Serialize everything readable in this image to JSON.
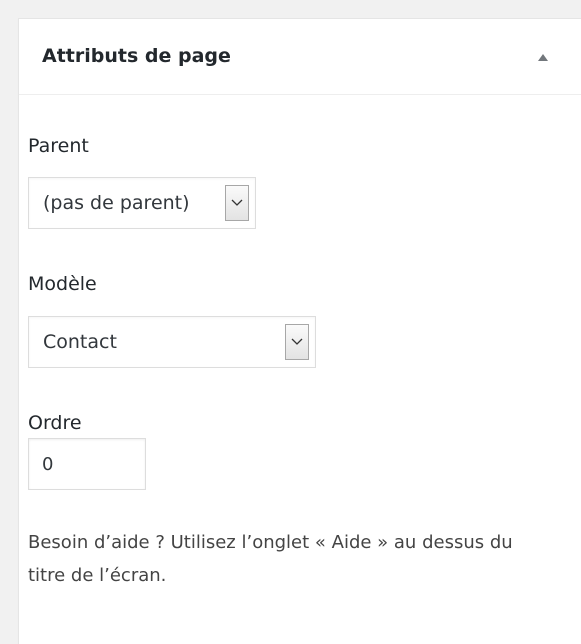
{
  "panel": {
    "title": "Attributs de page",
    "toggle_icon": "arrow-up-triangle-icon"
  },
  "parent": {
    "label": "Parent",
    "selected": "(pas de parent)",
    "icon": "chevron-down-icon"
  },
  "template": {
    "label": "Modèle",
    "selected": "Contact",
    "icon": "chevron-down-icon"
  },
  "order": {
    "label": "Ordre",
    "value": "0"
  },
  "help": {
    "text": "Besoin d’aide ? Utilisez l’onglet « Aide » au dessus du titre de l’écran."
  },
  "colors": {
    "background": "#f1f1f1",
    "panel": "#ffffff",
    "border": "#e5e5e5",
    "text": "#23282d"
  }
}
